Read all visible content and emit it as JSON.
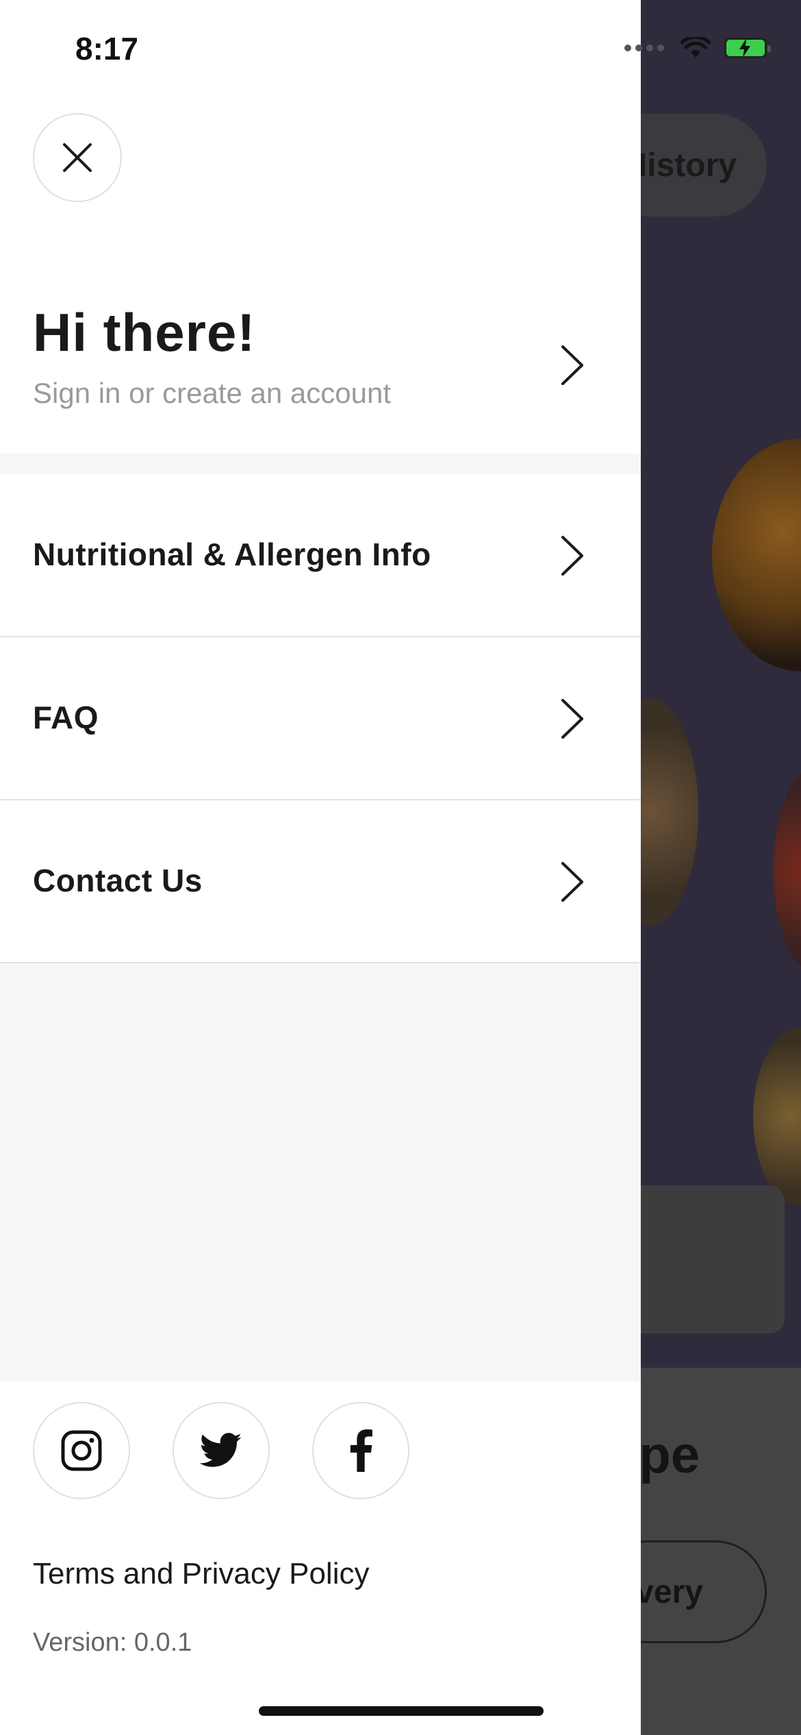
{
  "status_bar": {
    "time": "8:17"
  },
  "background_app": {
    "history_button_label": "History",
    "panel_title_fragment": "pe",
    "delivery_button_label_fragment": "very"
  },
  "drawer": {
    "close_icon": "close-icon",
    "greeting": {
      "title": "Hi there!",
      "subtitle": "Sign in or create an account"
    },
    "menu_items": [
      {
        "label": "Nutritional & Allergen Info"
      },
      {
        "label": "FAQ"
      },
      {
        "label": "Contact Us"
      }
    ],
    "social_links": [
      {
        "icon": "instagram-icon"
      },
      {
        "icon": "twitter-icon"
      },
      {
        "icon": "facebook-icon"
      }
    ],
    "terms_label": "Terms and Privacy Policy",
    "version_text": "Version: 0.0.1"
  },
  "colors": {
    "drawer_background": "#ffffff",
    "drawer_gap": "#f6f6f6",
    "overlay_background": "#2f2b3d",
    "battery": "#3ccf4e",
    "primary_text": "#1a1a1a",
    "secondary_text": "#9a9a9a"
  }
}
